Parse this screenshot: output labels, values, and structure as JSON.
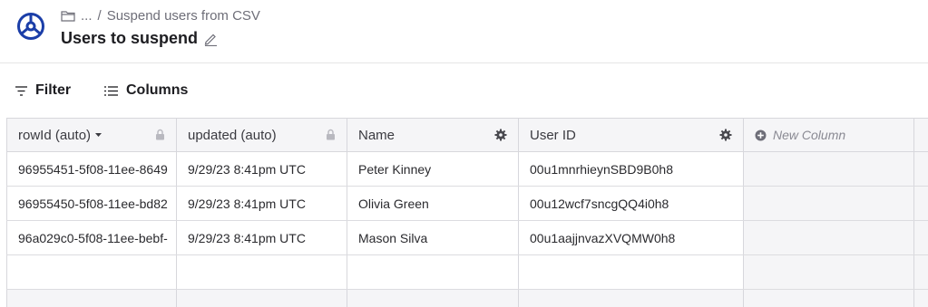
{
  "header": {
    "breadcrumb_prefix": "...",
    "breadcrumb_separator": "/",
    "breadcrumb_current": "Suspend users from CSV",
    "title": "Users to suspend"
  },
  "toolbar": {
    "filter_label": "Filter",
    "columns_label": "Columns"
  },
  "table": {
    "columns": [
      {
        "label": "rowId (auto)",
        "icon": "lock-icon",
        "sortable": true
      },
      {
        "label": "updated (auto)",
        "icon": "lock-icon"
      },
      {
        "label": "Name",
        "icon": "gear-icon"
      },
      {
        "label": "User ID",
        "icon": "gear-icon"
      },
      {
        "label": "New Column",
        "icon": "plus-circle-icon"
      }
    ],
    "rows": [
      {
        "rowId": "96955451-5f08-11ee-8649",
        "updated": "9/29/23 8:41pm UTC",
        "name": "Peter Kinney",
        "userId": "00u1mnrhieynSBD9B0h8"
      },
      {
        "rowId": "96955450-5f08-11ee-bd82",
        "updated": "9/29/23 8:41pm UTC",
        "name": "Olivia Green",
        "userId": "00u12wcf7sncgQQ4i0h8"
      },
      {
        "rowId": "96a029c0-5f08-11ee-bebf-",
        "updated": "9/29/23 8:41pm UTC",
        "name": "Mason Silva",
        "userId": "00u1aajjnvazXVQMW0h8"
      }
    ]
  },
  "colors": {
    "accent": "#1b3ea8",
    "border": "#d7d7dc",
    "header_bg": "#f5f5f7"
  }
}
